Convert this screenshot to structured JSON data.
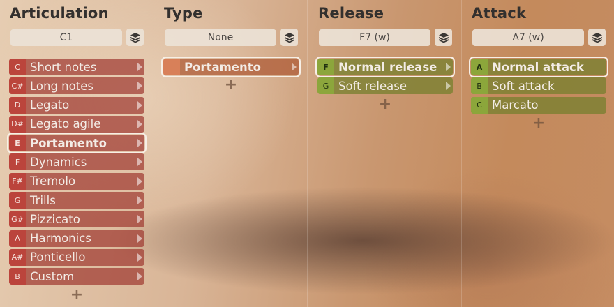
{
  "columns": [
    {
      "title": "Articulation",
      "selector": "C1",
      "items": [
        {
          "key": "C",
          "label": "Short notes"
        },
        {
          "key": "C#",
          "label": "Long notes"
        },
        {
          "key": "D",
          "label": "Legato"
        },
        {
          "key": "D#",
          "label": "Legato agile"
        },
        {
          "key": "E",
          "label": "Portamento"
        },
        {
          "key": "F",
          "label": "Dynamics"
        },
        {
          "key": "F#",
          "label": "Tremolo"
        },
        {
          "key": "G",
          "label": "Trills"
        },
        {
          "key": "G#",
          "label": "Pizzicato"
        },
        {
          "key": "A",
          "label": "Harmonics"
        },
        {
          "key": "A#",
          "label": "Ponticello"
        },
        {
          "key": "B",
          "label": "Custom"
        }
      ]
    },
    {
      "title": "Type",
      "selector": "None",
      "items": [
        {
          "key": "",
          "label": "Portamento"
        }
      ]
    },
    {
      "title": "Release",
      "selector": "F7 (w)",
      "items": [
        {
          "key": "F",
          "label": "Normal release"
        },
        {
          "key": "G",
          "label": "Soft release"
        }
      ]
    },
    {
      "title": "Attack",
      "selector": "A7 (w)",
      "items": [
        {
          "key": "A",
          "label": "Normal attack"
        },
        {
          "key": "B",
          "label": "Soft attack"
        },
        {
          "key": "C",
          "label": "Marcato"
        }
      ]
    }
  ],
  "add_symbol": "+",
  "icons": {
    "layers": "layers-icon",
    "submenu": "chevron-right-icon",
    "add": "plus-icon"
  },
  "colors": {
    "articulation_item": "#a03a32",
    "release_attack_item": "#78802f",
    "type_item": "#b0603c",
    "selected_outline": "#f7efe6"
  }
}
